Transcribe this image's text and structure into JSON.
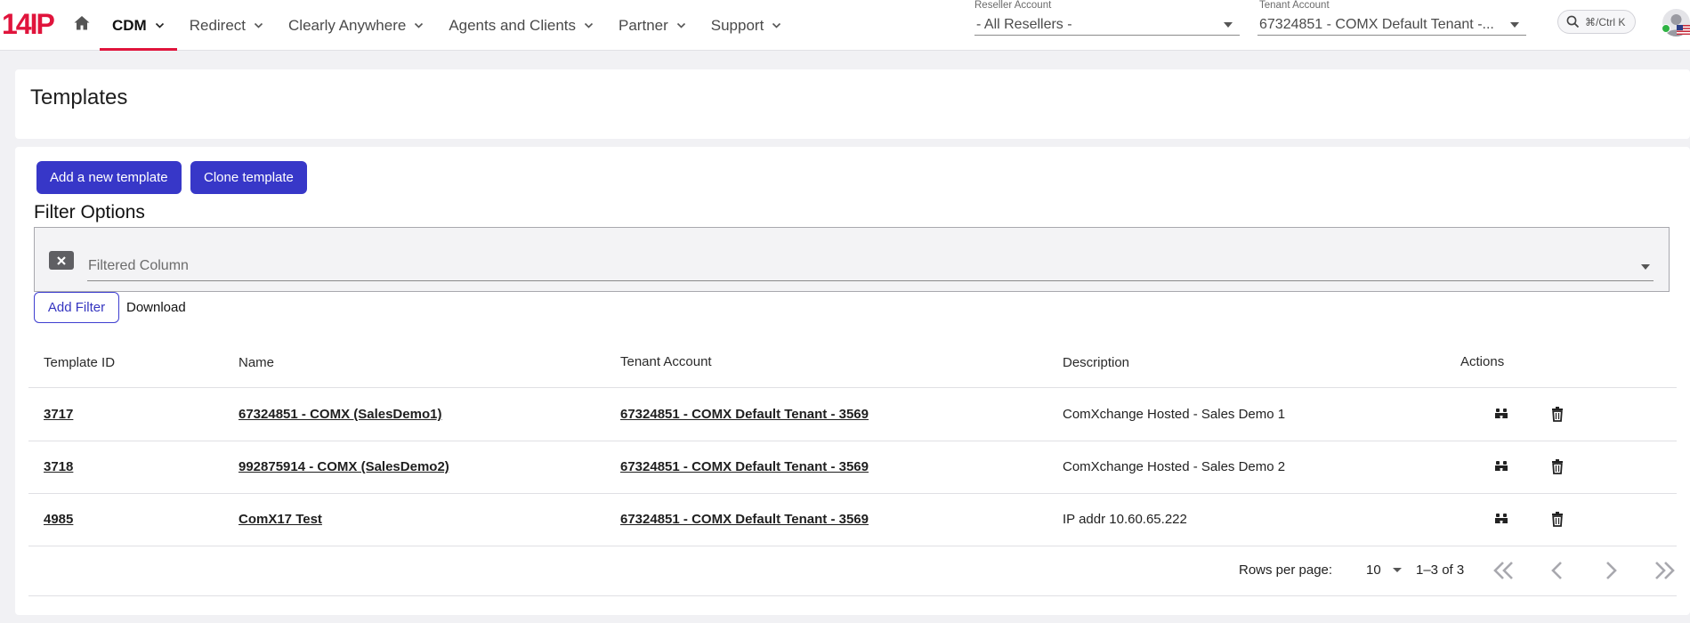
{
  "header": {
    "logo_text": "14IP",
    "nav": [
      {
        "label": "CDM",
        "active": true
      },
      {
        "label": "Redirect",
        "active": false
      },
      {
        "label": "Clearly Anywhere",
        "active": false
      },
      {
        "label": "Agents and Clients",
        "active": false
      },
      {
        "label": "Partner",
        "active": false
      },
      {
        "label": "Support",
        "active": false
      }
    ],
    "reseller": {
      "label": "Reseller Account",
      "value": "-  All Resellers -"
    },
    "tenant": {
      "label": "Tenant Account",
      "value": "67324851 - COMX Default Tenant -..."
    },
    "search_shortcut": "⌘/Ctrl K"
  },
  "page": {
    "title": "Templates"
  },
  "toolbar": {
    "add_label": "Add a new template",
    "clone_label": "Clone template"
  },
  "filter": {
    "heading": "Filter Options",
    "field_placeholder": "Filtered Column",
    "add_filter_label": "Add Filter",
    "download_label": "Download"
  },
  "table": {
    "columns": [
      "Template ID",
      "Name",
      "Tenant Account",
      "Description",
      "Actions"
    ],
    "rows": [
      {
        "id": "3717",
        "name": "67324851 - COMX (SalesDemo1)",
        "tenant": "67324851 - COMX Default Tenant - 3569",
        "description": "ComXchange Hosted - Sales Demo 1"
      },
      {
        "id": "3718",
        "name": "992875914 - COMX (SalesDemo2)",
        "tenant": "67324851 - COMX Default Tenant - 3569",
        "description": "ComXchange Hosted - Sales Demo 2"
      },
      {
        "id": "4985",
        "name": "ComX17 Test",
        "tenant": "67324851 - COMX Default Tenant - 3569",
        "description": "IP addr 10.60.65.222"
      }
    ]
  },
  "pagination": {
    "rows_per_page_label": "Rows per page:",
    "rows_per_page": "10",
    "range": "1–3 of 3"
  },
  "colors": {
    "accent": "#3737c8",
    "brand": "#e0143c",
    "status_online": "#2fb344"
  }
}
